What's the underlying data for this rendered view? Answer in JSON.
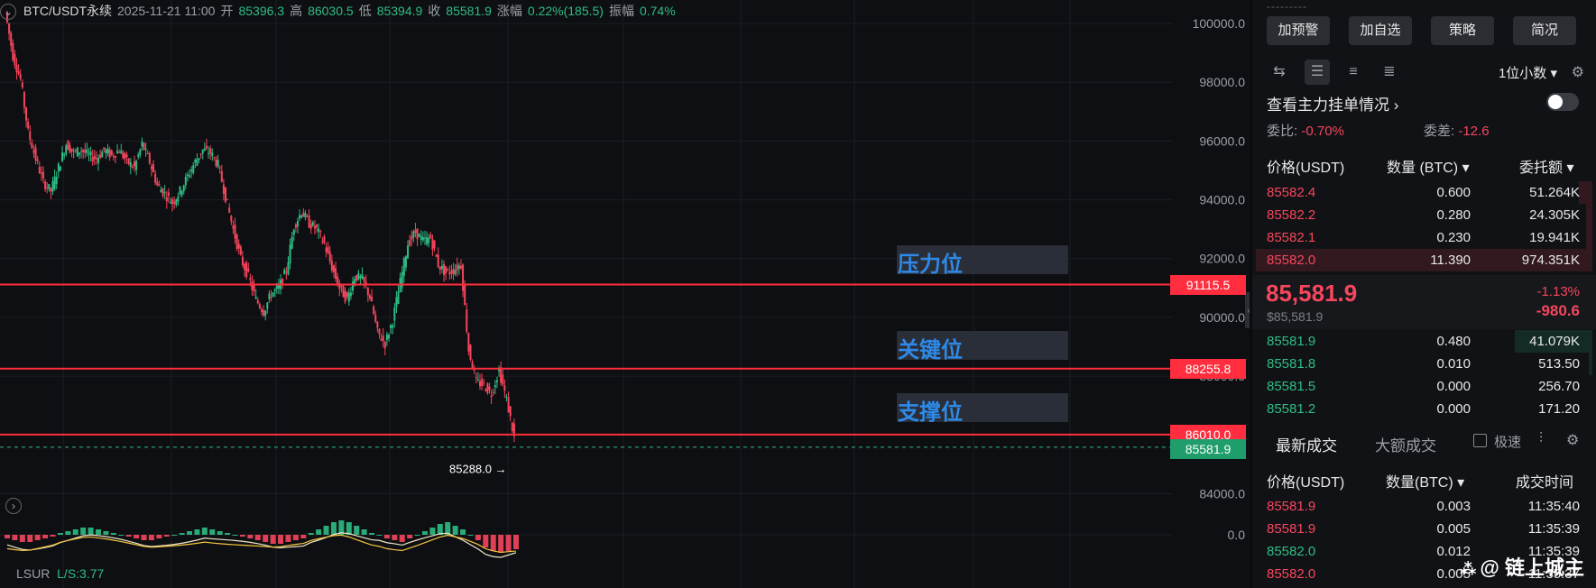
{
  "header": {
    "symbol": "BTC/USDT永续",
    "datetime": "2025-11-21 11:00",
    "open_label": "开",
    "open": "85396.3",
    "high_label": "高",
    "high": "86030.5",
    "low_label": "低",
    "low": "85394.9",
    "close_label": "收",
    "close": "85581.9",
    "change_label": "涨幅",
    "change": "0.22%(185.5)",
    "amplitude_label": "振幅",
    "amplitude": "0.74%"
  },
  "chart_data": {
    "type": "candlestick",
    "y_axis_ticks": [
      "100000.0",
      "98000.0",
      "96000.0",
      "94000.0",
      "92000.0",
      "90000.0",
      "88000.0",
      "84000.0"
    ],
    "ylim": [
      83000,
      100800
    ],
    "levels": [
      {
        "label": "压力位",
        "value": 91115.5,
        "tag": "91115.5"
      },
      {
        "label": "关键位",
        "value": 88255.8,
        "tag": "88255.8"
      },
      {
        "label": "支撑位",
        "value": 86010.0,
        "tag": "86010.0"
      }
    ],
    "current_price": {
      "value": 85581.9,
      "tag": "85581.9"
    },
    "low_marker": {
      "value": 85288.0,
      "text": "85288.0"
    },
    "close_path": [
      100400,
      98900,
      98100,
      96300,
      95400,
      94600,
      94300,
      95100,
      95900,
      95600,
      95700,
      95500,
      95400,
      95700,
      95500,
      95700,
      95300,
      95100,
      95900,
      95300,
      94500,
      94200,
      93900,
      94300,
      94800,
      95300,
      95700,
      95600,
      95200,
      94100,
      93000,
      92000,
      91400,
      90600,
      90200,
      90800,
      91000,
      91600,
      93100,
      93600,
      93200,
      93000,
      92500,
      91700,
      91000,
      90600,
      91400,
      91300,
      90700,
      89500,
      89100,
      89900,
      91200,
      92500,
      92900,
      92600,
      92700,
      91800,
      91500,
      91600,
      91800,
      88900,
      87800,
      87700,
      87400,
      88200,
      87200,
      85900
    ],
    "macd": {
      "zero_tick": "0.0",
      "histogram": [
        -2,
        -3,
        -4,
        -4,
        -3,
        -2,
        -1,
        1,
        2,
        3,
        4,
        4,
        3,
        2,
        1,
        0,
        -1,
        -2,
        -3,
        -3,
        -2,
        -1,
        0,
        1,
        2,
        3,
        4,
        3,
        2,
        1,
        0,
        -1,
        -2,
        -3,
        -4,
        -5,
        -5,
        -4,
        -3,
        -2,
        1,
        3,
        5,
        7,
        8,
        7,
        5,
        3,
        1,
        0,
        -2,
        -3,
        -4,
        -2,
        0,
        2,
        4,
        6,
        7,
        5,
        3,
        0,
        -3,
        -7,
        -9,
        -10,
        -9,
        -8
      ]
    }
  },
  "indicator": {
    "name": "LSUR",
    "value": "L/S:3.77"
  },
  "sidebar": {
    "dashes": "---------",
    "buttons": [
      "加预警",
      "加自选",
      "策略",
      "简况"
    ],
    "precision": "1位小数",
    "depth_link": "查看主力挂单情况",
    "ratio_label": "委比:",
    "ratio_value": "-0.70%",
    "diff_label": "委差:",
    "diff_value": "-12.6",
    "ob_headers": {
      "price": "价格(USDT)",
      "qty": "数量 (BTC)",
      "total": "委托额"
    },
    "asks": [
      {
        "price": "85582.4",
        "qty": "0.600",
        "total": "51.264K",
        "depth": 0.04
      },
      {
        "price": "85582.2",
        "qty": "0.280",
        "total": "24.305K",
        "depth": 0.02
      },
      {
        "price": "85582.1",
        "qty": "0.230",
        "total": "19.941K",
        "depth": 0.02
      },
      {
        "price": "85582.0",
        "qty": "11.390",
        "total": "974.351K",
        "depth": 1.0
      }
    ],
    "mid": {
      "price": "85,581.9",
      "usd": "$85,581.9",
      "pct": "-1.13%",
      "chg": "-980.6"
    },
    "bids": [
      {
        "price": "85581.9",
        "qty": "0.480",
        "total": "41.079K",
        "depth": 0.23
      },
      {
        "price": "85581.8",
        "qty": "0.010",
        "total": "513.50",
        "depth": 0.01
      },
      {
        "price": "85581.5",
        "qty": "0.000",
        "total": "256.70",
        "depth": 0.0
      },
      {
        "price": "85581.2",
        "qty": "0.000",
        "total": "171.20",
        "depth": 0.0
      }
    ],
    "trade_tabs": {
      "latest": "最新成交",
      "large": "大额成交",
      "fast": "极速"
    },
    "trade_headers": {
      "price": "价格(USDT)",
      "qty": "数量(BTC)",
      "time": "成交时间"
    },
    "trades": [
      {
        "price": "85581.9",
        "qty": "0.003",
        "time": "11:35:40",
        "side": "sell"
      },
      {
        "price": "85581.9",
        "qty": "0.005",
        "time": "11:35:39",
        "side": "sell"
      },
      {
        "price": "85582.0",
        "qty": "0.012",
        "time": "11:35:39",
        "side": "buy"
      },
      {
        "price": "85582.0",
        "qty": "0.005",
        "time": "11:35:37",
        "side": "sell"
      }
    ]
  },
  "watermark": "链上城主",
  "colors": {
    "up": "#2ebd85",
    "down": "#f6465d",
    "level": "#ff2d3d",
    "accent": "#2e8ae6"
  }
}
